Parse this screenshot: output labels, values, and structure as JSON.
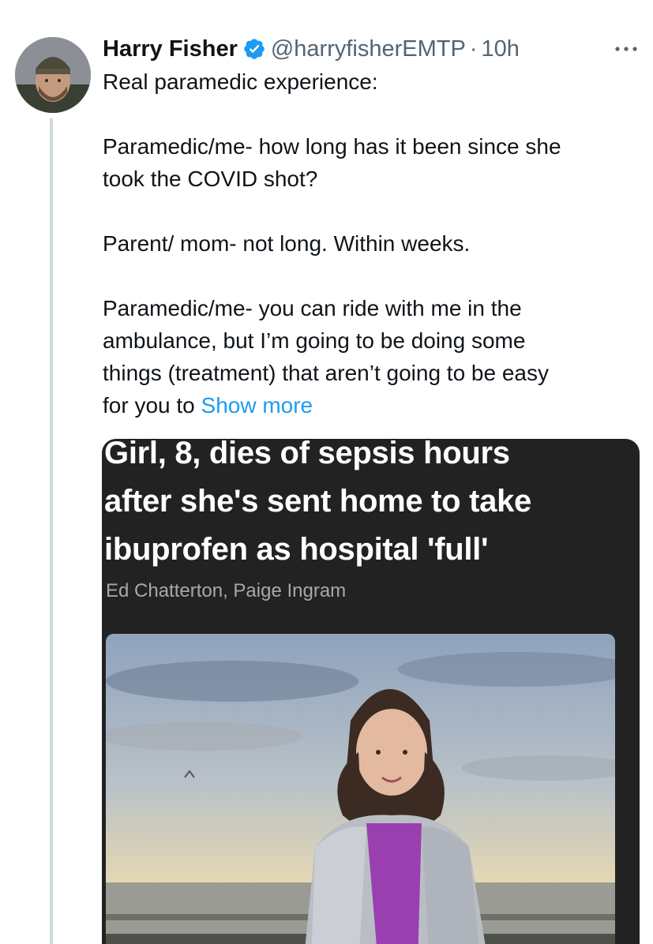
{
  "tweet": {
    "author": {
      "display_name": "Harry Fisher",
      "handle": "@harryfisherEMTP",
      "separator": "·",
      "time": "10h",
      "verified": true
    },
    "more_icon": "more-horizontal-icon",
    "text_lines": [
      "Real paramedic experience:",
      "",
      "Paramedic/me- how long has it been since she",
      "took the COVID shot?",
      "",
      "Parent/ mom- not long. Within weeks.",
      "",
      "Paramedic/me- you can ride with me in the",
      "ambulance, but I’m going to be doing some",
      "things (treatment) that aren’t going to be easy",
      "for you to"
    ],
    "show_more": "Show more",
    "media": {
      "headline_lines": [
        "Girl, 8, dies of sepsis hours",
        "after she's sent home to take",
        "ibuprofen as hospital 'full'"
      ],
      "byline": "Ed Chatterton, Paige Ingram"
    }
  },
  "colors": {
    "text": "#0f1419",
    "secondary": "#536471",
    "link": "#1d9bf0",
    "verified": "#1d9bf0",
    "card_bg": "#222222",
    "thread_line": "#cfd9de"
  }
}
